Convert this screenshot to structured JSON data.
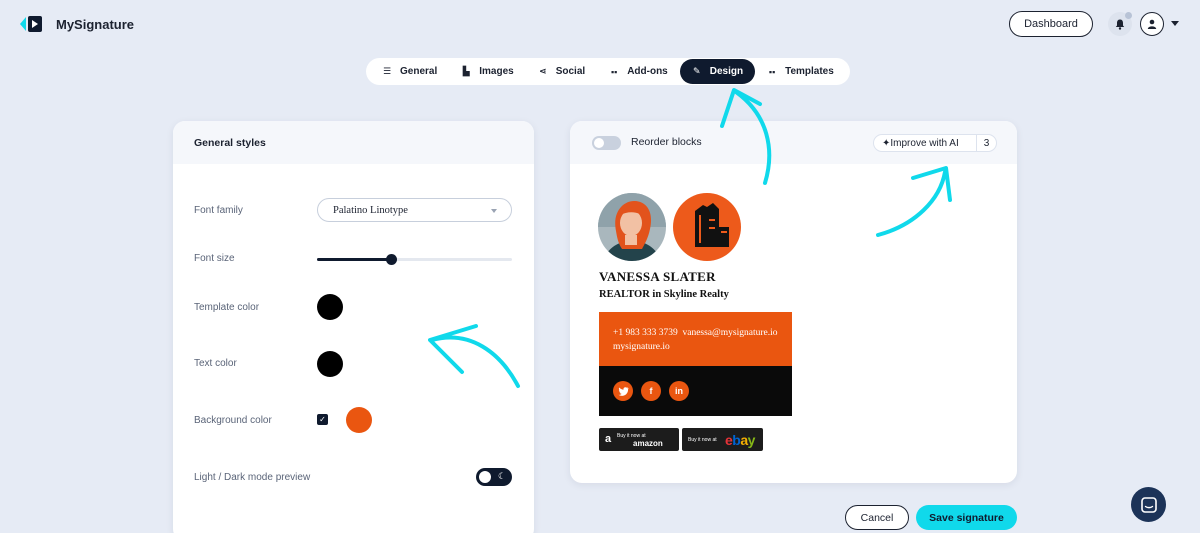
{
  "app": {
    "name": "MySignature"
  },
  "header": {
    "dashboard_label": "Dashboard"
  },
  "tabs": [
    {
      "label": "General",
      "icon": "lines-icon"
    },
    {
      "label": "Images",
      "icon": "image-icon"
    },
    {
      "label": "Social",
      "icon": "share-icon"
    },
    {
      "label": "Add-ons",
      "icon": "grid-icon"
    },
    {
      "label": "Design",
      "icon": "brush-icon",
      "active": true
    },
    {
      "label": "Templates",
      "icon": "grid-icon"
    }
  ],
  "general_styles": {
    "title": "General styles",
    "font_family_label": "Font family",
    "font_family_value": "Palatino Linotype",
    "font_size_label": "Font size",
    "font_size_level": 0.38,
    "template_color_label": "Template color",
    "template_color": "#000000",
    "text_color_label": "Text color",
    "text_color": "#000000",
    "background_color_label": "Background color",
    "background_color_enabled": true,
    "background_color": "#ea5610",
    "dark_mode_label": "Light / Dark mode preview"
  },
  "preview": {
    "reorder_label": "Reorder blocks",
    "reorder_enabled": false,
    "ai_label": "Improve with AI",
    "ai_count": "3",
    "signature": {
      "name": "VANESSA SLATER",
      "title": "REALTOR in Skyline Realty",
      "phone": "+1 983 333 3739",
      "email": "vanessa@mysignature.io",
      "website": "mysignature.io",
      "socials": [
        {
          "icon": "twitter-icon"
        },
        {
          "icon": "facebook-icon"
        },
        {
          "icon": "linkedin-icon"
        }
      ],
      "badges": [
        {
          "small": "Buy it now at",
          "big": "amazon"
        },
        {
          "small": "Buy it now at",
          "big": "ebay"
        }
      ]
    }
  },
  "actions": {
    "cancel_label": "Cancel",
    "save_label": "Save signature"
  },
  "colors": {
    "accent": "#10d9eb",
    "primary": "#0f1a2e",
    "orange": "#ea5610",
    "background": "#e6ebf5"
  }
}
